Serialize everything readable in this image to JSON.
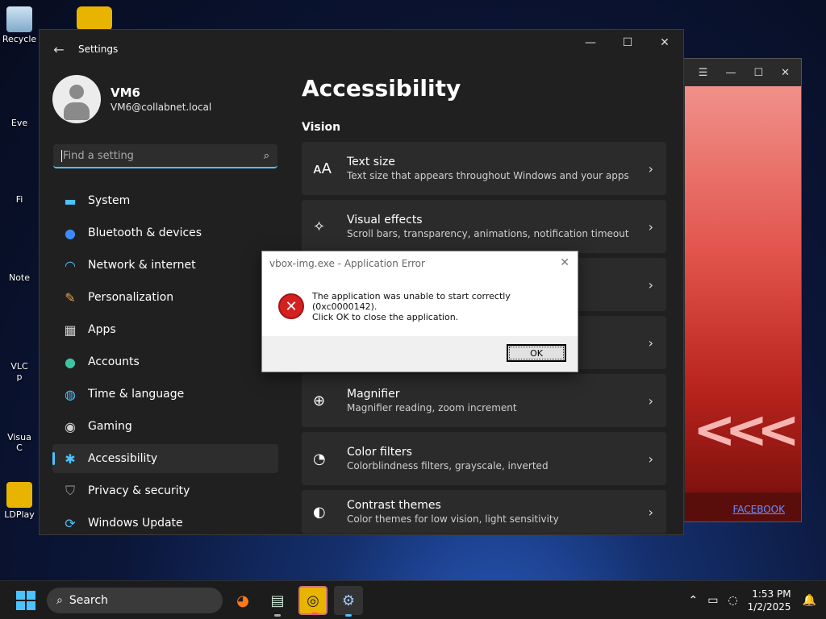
{
  "desktop": {
    "icons": [
      "Recycle",
      "Eve",
      "Fi",
      "Note",
      "VLC\np",
      "Visua\nC",
      "LDPlay"
    ]
  },
  "bg_app": {
    "menu_icon": "hamburger-icon",
    "facebook_link": "FACEBOOK"
  },
  "settings": {
    "back_icon": "arrow-left-icon",
    "title": "Settings",
    "user": {
      "name": "VM6",
      "email": "VM6@collabnet.local"
    },
    "search": {
      "placeholder": "Find a setting"
    },
    "nav": [
      {
        "label": "System",
        "icon": "system-icon",
        "color": "#4cc2ff"
      },
      {
        "label": "Bluetooth & devices",
        "icon": "bluetooth-icon",
        "color": "#3b8cff"
      },
      {
        "label": "Network & internet",
        "icon": "wifi-icon",
        "color": "#4cc2ff"
      },
      {
        "label": "Personalization",
        "icon": "brush-icon",
        "color": "#e0a060"
      },
      {
        "label": "Apps",
        "icon": "apps-icon",
        "color": "#cfcfcf"
      },
      {
        "label": "Accounts",
        "icon": "person-icon",
        "color": "#3fc3a0"
      },
      {
        "label": "Time & language",
        "icon": "globe-icon",
        "color": "#4cc2ff"
      },
      {
        "label": "Gaming",
        "icon": "gamepad-icon",
        "color": "#cfcfcf"
      },
      {
        "label": "Accessibility",
        "icon": "accessibility-icon",
        "color": "#4cc2ff",
        "active": true
      },
      {
        "label": "Privacy & security",
        "icon": "shield-icon",
        "color": "#9a9a9a"
      },
      {
        "label": "Windows Update",
        "icon": "update-icon",
        "color": "#4cc2ff"
      }
    ],
    "page_title": "Accessibility",
    "section": "Vision",
    "cards": [
      {
        "title": "Text size",
        "subtitle": "Text size that appears throughout Windows and your apps",
        "icon": "text-size-icon"
      },
      {
        "title": "Visual effects",
        "subtitle": "Scroll bars, transparency, animations, notification timeout",
        "icon": "sparkle-icon"
      },
      {
        "title": "",
        "subtitle": "",
        "icon": ""
      },
      {
        "title": "",
        "subtitle": "",
        "icon": ""
      },
      {
        "title": "Magnifier",
        "subtitle": "Magnifier reading, zoom increment",
        "icon": "magnifier-icon"
      },
      {
        "title": "Color filters",
        "subtitle": "Colorblindness filters, grayscale, inverted",
        "icon": "palette-icon"
      },
      {
        "title": "Contrast themes",
        "subtitle": "Color themes for low vision, light sensitivity",
        "icon": "contrast-icon"
      }
    ]
  },
  "dialog": {
    "title": "vbox-img.exe - Application Error",
    "message_line1": "The application was unable to start correctly (0xc0000142).",
    "message_line2": "Click OK to close the application.",
    "ok_label": "OK"
  },
  "taskbar": {
    "search_label": "Search",
    "time": "1:53 PM",
    "date": "1/2/2025"
  },
  "colors": {
    "accent": "#4cc2ff",
    "error_red": "#d32020"
  }
}
